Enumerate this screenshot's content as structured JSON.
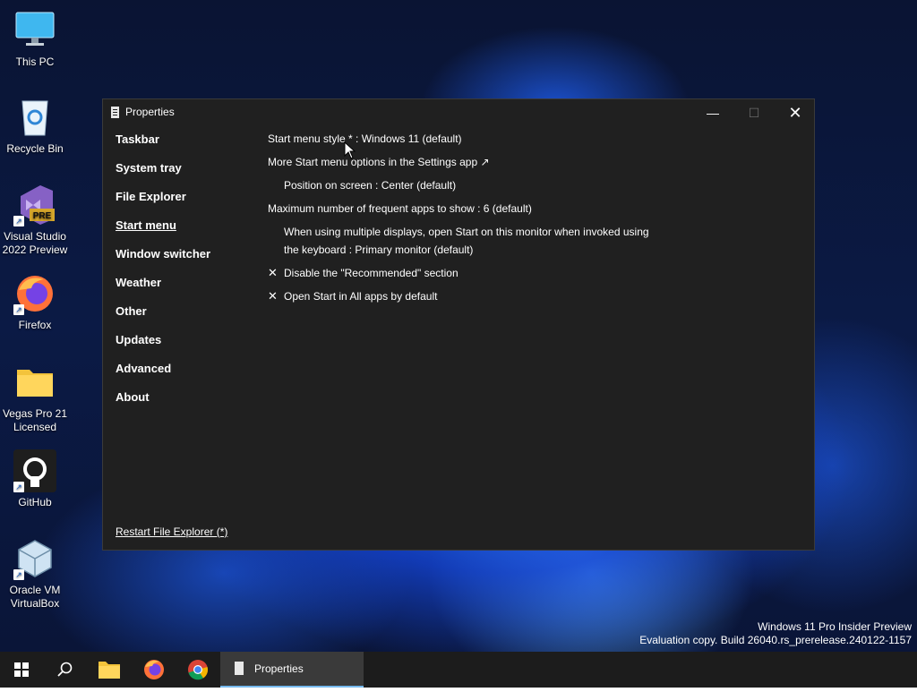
{
  "desktop": {
    "icons": [
      {
        "label": "This PC"
      },
      {
        "label": "Recycle Bin"
      },
      {
        "label": "Visual Studio 2022 Preview",
        "badge": "PRE"
      },
      {
        "label": "Firefox"
      },
      {
        "label": "Vegas Pro 21 Licensed"
      },
      {
        "label": "GitHub"
      },
      {
        "label": "Oracle VM VirtualBox"
      }
    ],
    "watermark": {
      "line1": "Windows 11 Pro Insider Preview",
      "line2": "Evaluation copy. Build 26040.rs_prerelease.240122-1157"
    }
  },
  "window": {
    "title": "Properties",
    "controls": {
      "minimize": "—",
      "maximize": "☐",
      "close": "✕"
    },
    "nav": [
      {
        "label": "Taskbar"
      },
      {
        "label": "System tray"
      },
      {
        "label": "File Explorer"
      },
      {
        "label": "Start menu",
        "active": true
      },
      {
        "label": "Window switcher"
      },
      {
        "label": "Weather"
      },
      {
        "label": "Other"
      },
      {
        "label": "Updates"
      },
      {
        "label": "Advanced"
      },
      {
        "label": "About"
      }
    ],
    "settings": {
      "start_menu_style": "Start menu style * : Windows 11 (default)",
      "more_options": "More Start menu options in the Settings app ↗",
      "position": "Position on screen : Center (default)",
      "max_frequent": "Maximum number of frequent apps to show : 6 (default)",
      "multi_display_1": "When using multiple displays, open Start on this monitor when invoked using",
      "multi_display_2": "the keyboard : Primary monitor (default)",
      "disable_recommended": "Disable the \"Recommended\" section",
      "open_all_apps": "Open Start in All apps by default",
      "checkmark": "✕"
    },
    "restart_link": "Restart File Explorer (*)"
  },
  "taskbar": {
    "active_app": "Properties"
  },
  "colors": {
    "window_bg": "#202020",
    "taskbar_bg": "#1c1c1c",
    "accent": "#76b9ed"
  }
}
